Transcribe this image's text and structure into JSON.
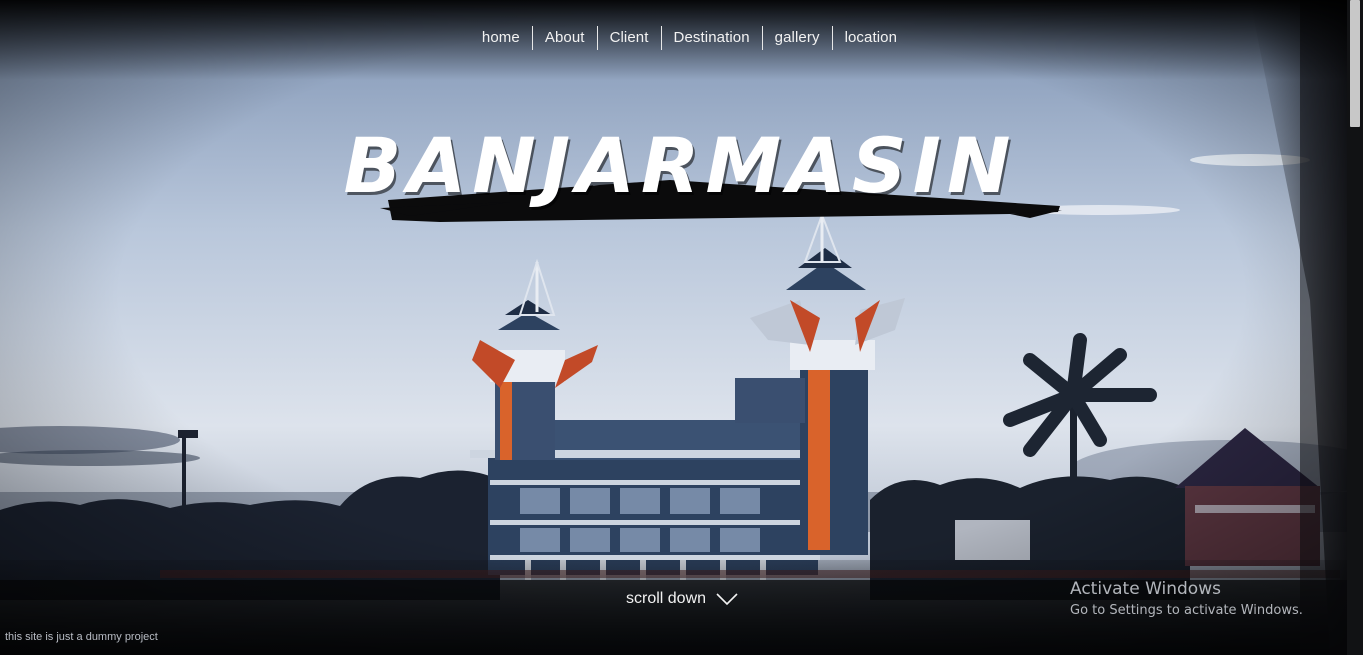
{
  "nav": {
    "items": [
      {
        "label": "home"
      },
      {
        "label": "About"
      },
      {
        "label": "Client"
      },
      {
        "label": "Destination"
      },
      {
        "label": "gallery"
      },
      {
        "label": "location"
      }
    ]
  },
  "hero": {
    "title": "BANJARMASIN"
  },
  "scroll": {
    "label": "scroll down",
    "icon": "chevron-down-icon"
  },
  "footer": {
    "note": "this site is just a dummy project"
  },
  "watermark": {
    "title": "Activate Windows",
    "subtitle": "Go to Settings to activate Windows."
  },
  "colors": {
    "sky_top": "#8fa4c2",
    "sky_bottom": "#dfe5ee",
    "building_blue": "#2b3f5c",
    "building_orange": "#d9632b",
    "text": "#f2f2f2"
  }
}
